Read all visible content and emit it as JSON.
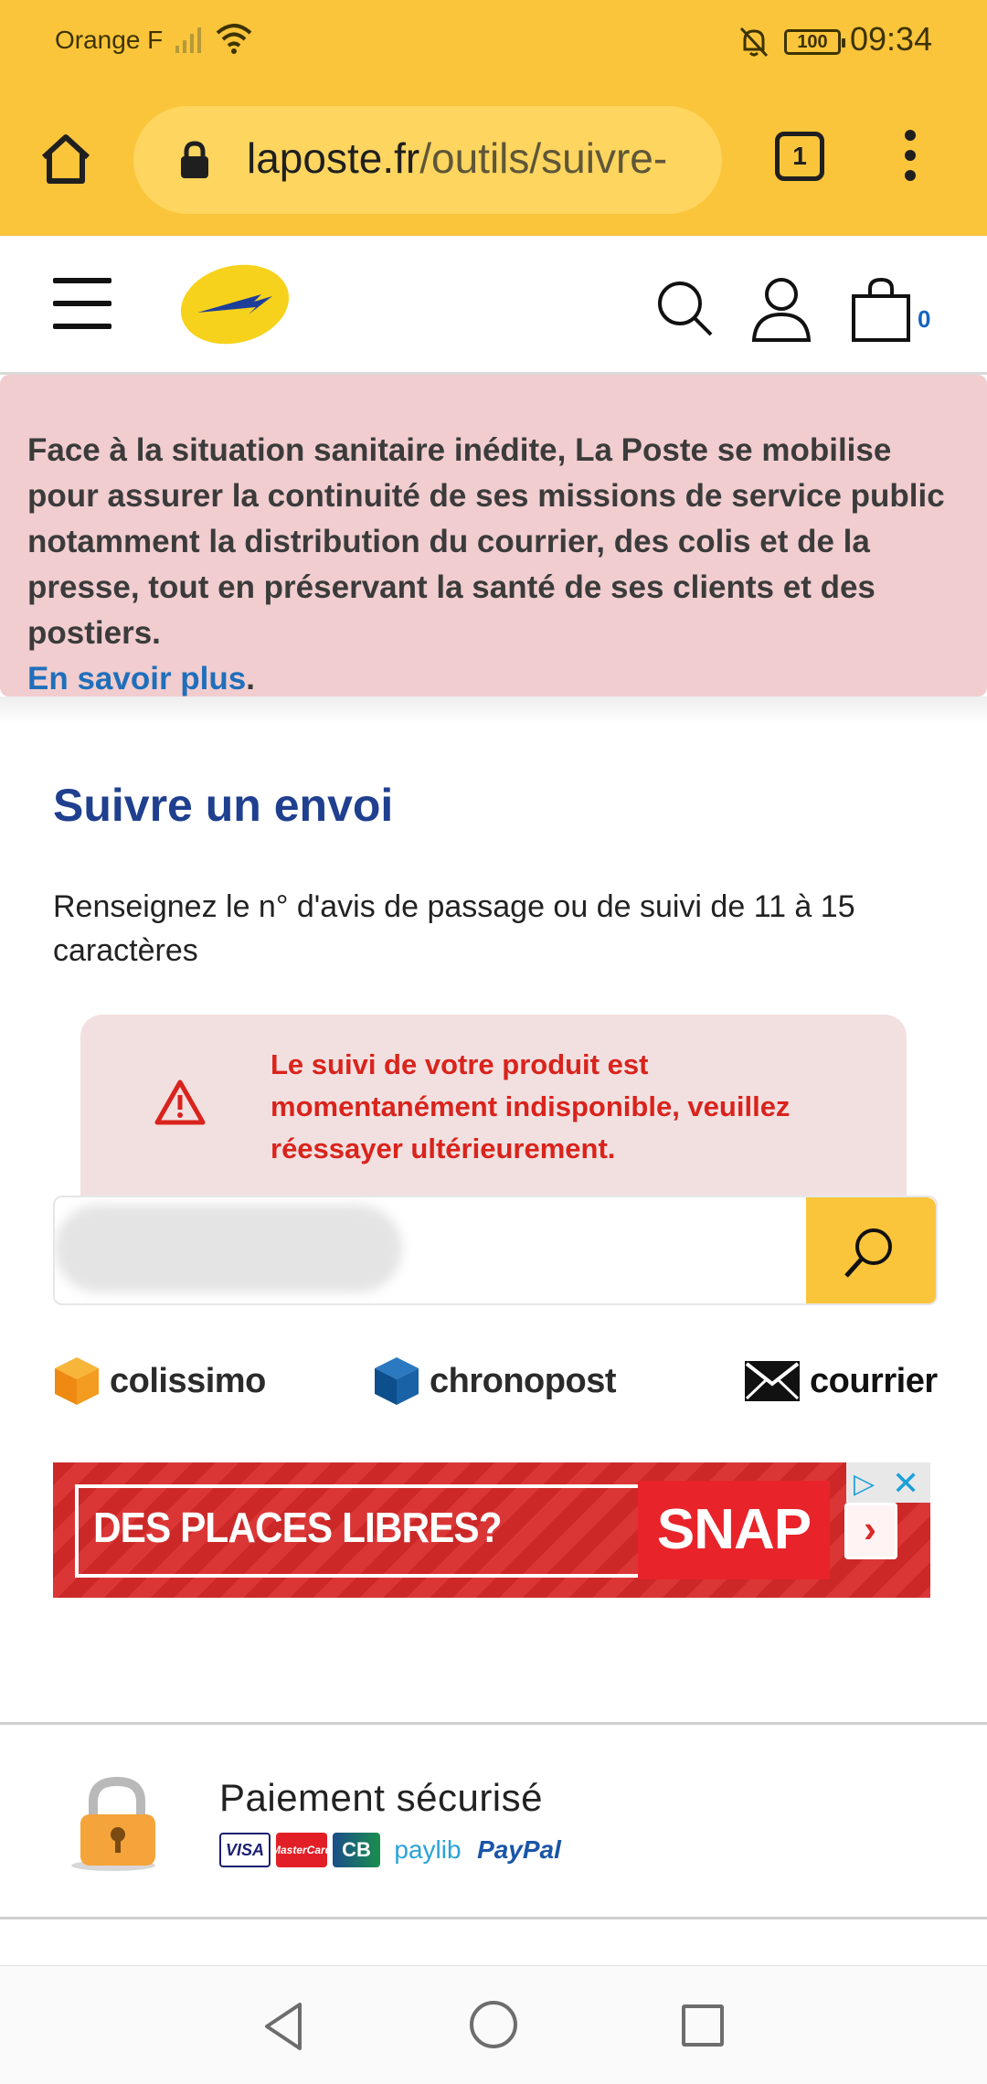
{
  "status_bar": {
    "carrier": "Orange F",
    "battery": "100",
    "time": "09:34"
  },
  "browser": {
    "url_domain": "laposte.fr",
    "url_path": "/outils/suivre-",
    "tab_count": "1"
  },
  "header": {
    "cart_count": "0"
  },
  "covid_banner": {
    "message": "Face à la situation sanitaire inédite, La Poste se mobilise pour assurer la continuité de ses missions de service public notamment la distribution du courrier, des colis et de la presse, tout en préservant la santé de ses clients et des postiers.",
    "link_label": "En savoir plus",
    "trailing": "."
  },
  "tracking": {
    "title": "Suivre un envoi",
    "instructions": "Renseignez le n° d'avis de passage ou de suivi de 11 à 15 caractères",
    "error": "Le suivi de votre produit est momentanément indisponible, veuillez réessayer ultérieurement.",
    "input_value": ""
  },
  "carriers": [
    {
      "label": "colissimo"
    },
    {
      "label": "chronopost"
    },
    {
      "label": "courrier"
    }
  ],
  "ad": {
    "headline": "DES PLACES LIBRES?",
    "brand": "SNAP"
  },
  "payment": {
    "title": "Paiement sécurisé",
    "methods": [
      "VISA",
      "MasterCard",
      "CB",
      "paylib",
      "PayPal"
    ]
  },
  "colors": {
    "chrome_yellow": "#fbc53b",
    "title_blue": "#1f3f8f",
    "link_blue": "#1f6fbb",
    "error_red": "#d9231c",
    "banner_pink": "#f1cdcf"
  },
  "icons": {
    "home": "home-icon",
    "lock": "lock-icon",
    "menu": "more-vert-icon",
    "hamburger": "hamburger-icon",
    "search": "search-icon",
    "user": "user-icon",
    "cart": "cart-icon",
    "warning": "warning-icon"
  }
}
